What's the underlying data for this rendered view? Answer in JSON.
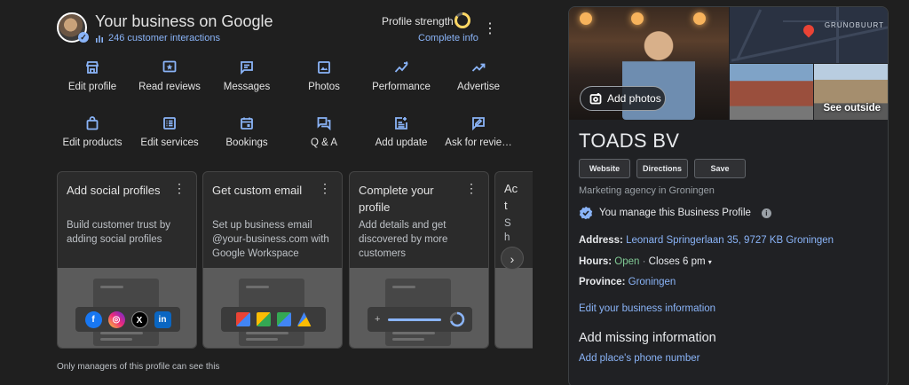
{
  "header": {
    "title": "Your business on Google",
    "interactions": "246 customer interactions",
    "profile_strength_label": "Profile strength",
    "complete_info_link": "Complete info",
    "profile_strength_progress": 0.85
  },
  "actions_row1": [
    {
      "label": "Edit profile",
      "icon": "storefront-icon"
    },
    {
      "label": "Read reviews",
      "icon": "star-review-icon"
    },
    {
      "label": "Messages",
      "icon": "message-icon"
    },
    {
      "label": "Photos",
      "icon": "photo-icon"
    },
    {
      "label": "Performance",
      "icon": "performance-icon"
    },
    {
      "label": "Advertise",
      "icon": "trending-up-icon"
    }
  ],
  "actions_row2": [
    {
      "label": "Edit products",
      "icon": "shopping-bag-icon"
    },
    {
      "label": "Edit services",
      "icon": "list-icon"
    },
    {
      "label": "Bookings",
      "icon": "calendar-icon"
    },
    {
      "label": "Q & A",
      "icon": "forum-icon"
    },
    {
      "label": "Add update",
      "icon": "post-add-icon"
    },
    {
      "label": "Ask for revie…",
      "icon": "rate-review-icon"
    }
  ],
  "cards": [
    {
      "title": "Add social profiles",
      "description": "Build customer trust by adding social profiles"
    },
    {
      "title": "Get custom email",
      "description": "Set up business email @your-business.com with Google Workspace"
    },
    {
      "title": "Complete your profile",
      "description": "Add details and get discovered by more customers"
    }
  ],
  "partial_card": {
    "line1": "Ac",
    "line2": "t",
    "line3": "S",
    "line4": "h"
  },
  "social_icons": [
    "f",
    "◎",
    "X",
    "in"
  ],
  "footnote": "Only managers of this profile can see this",
  "right": {
    "add_photos": "Add photos",
    "map_label": "GRUNOBUURT",
    "see_outside": "See outside",
    "business_name": "TOADS BV",
    "buttons": [
      "Website",
      "Directions",
      "Save"
    ],
    "category": "Marketing agency in Groningen",
    "manage_text": "You manage this Business Profile",
    "address_label": "Address:",
    "address_value": "Leonard Springerlaan 35, 9727 KB Groningen",
    "hours_label": "Hours:",
    "hours_open": "Open",
    "hours_sep": " · ",
    "hours_close": "Closes 6 pm",
    "province_label": "Province:",
    "province_value": "Groningen",
    "edit_link": "Edit your business information",
    "missing_title": "Add missing information",
    "phone_link": "Add place's phone number"
  },
  "colors": {
    "accent": "#8ab4f8",
    "open": "#81c995",
    "progress": "#fdd663"
  }
}
